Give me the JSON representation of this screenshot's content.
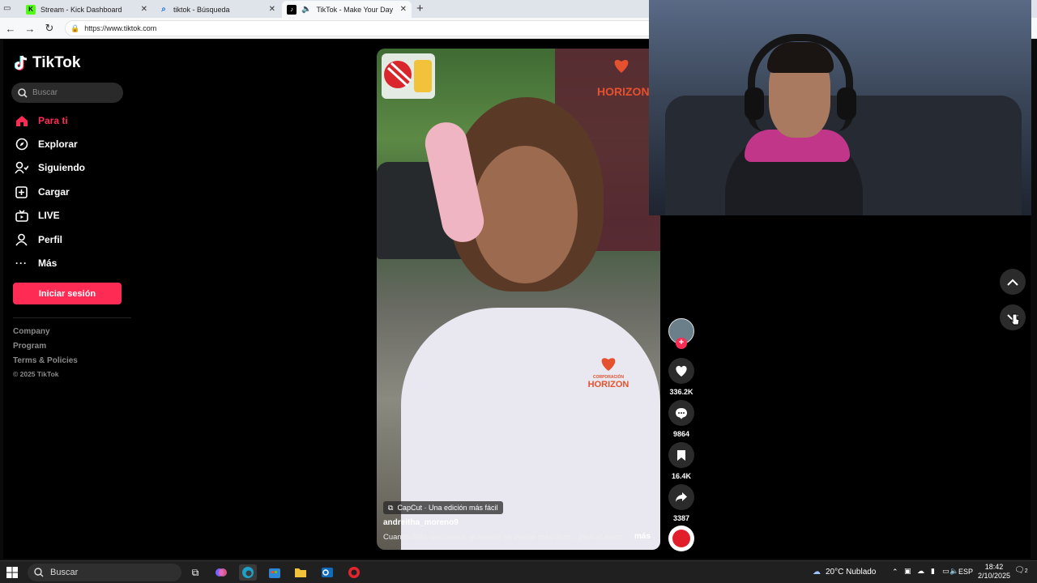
{
  "browser": {
    "tabs": [
      {
        "label": "Stream - Kick Dashboard",
        "icon": "kick-icon",
        "color": "#53fc18"
      },
      {
        "label": "tiktok - Búsqueda",
        "icon": "search-icon",
        "color": "#1a73e8"
      },
      {
        "label": "TikTok - Make Your Day",
        "icon": "tiktok-icon",
        "color": "#000000",
        "muted_icon": "speaker-icon",
        "active": true
      }
    ],
    "url": "https://www.tiktok.com"
  },
  "sidebar": {
    "logo": "TikTok",
    "search_placeholder": "Buscar",
    "items": [
      {
        "label": "Para ti",
        "icon": "home-icon",
        "active": true
      },
      {
        "label": "Explorar",
        "icon": "compass-icon"
      },
      {
        "label": "Siguiendo",
        "icon": "following-icon"
      },
      {
        "label": "Cargar",
        "icon": "upload-icon"
      },
      {
        "label": "LIVE",
        "icon": "live-icon"
      },
      {
        "label": "Perfil",
        "icon": "profile-icon"
      },
      {
        "label": "Más",
        "icon": "more-icon"
      }
    ],
    "login_button": "Iniciar sesión",
    "footer": [
      "Company",
      "Program",
      "Terms & Policies",
      "© 2025 TikTok"
    ]
  },
  "video": {
    "capcut_label": "CapCut · Una edición más fácil",
    "author": "andreitha_moreno9",
    "description": "Cuando falta una mamá, el mundo se vuelve más duro... pero el amor ...",
    "more_label": "más",
    "shirt_logo_top": "CORPORACIÓN",
    "shirt_logo_bottom": "HORIZON",
    "banner_text": "HORIZON"
  },
  "actions": {
    "likes": "336.2K",
    "comments": "9864",
    "saves": "16.4K",
    "shares": "3387"
  },
  "colors": {
    "accent": "#fe2c55",
    "background": "#000000"
  },
  "taskbar": {
    "search_placeholder": "Buscar",
    "weather": "20°C  Nublado",
    "language": "ESP",
    "time": "18:42",
    "date": "2/10/2025",
    "notifications": "2"
  }
}
